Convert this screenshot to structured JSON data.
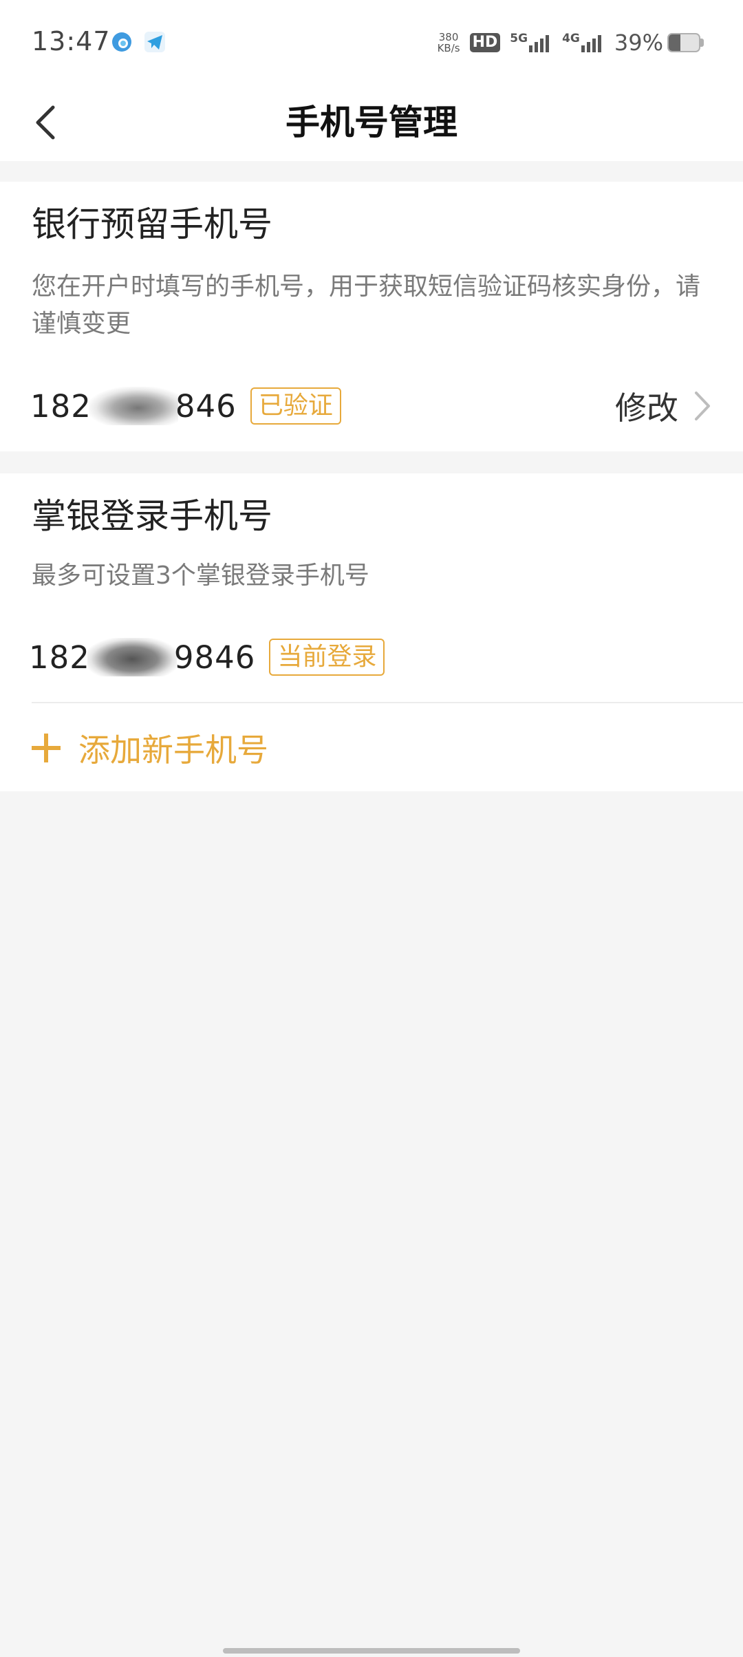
{
  "status_bar": {
    "time": "13:47",
    "net_speed_value": "380",
    "net_speed_unit": "KB/s",
    "hd_label": "HD",
    "sim1_label": "5G",
    "sim2_label": "4G",
    "battery_percent": "39%",
    "battery_level": 0.39,
    "app_icons": [
      "browser-app-icon",
      "telegram-app-icon"
    ]
  },
  "nav": {
    "title": "手机号管理",
    "back_icon": "chevron-left-icon"
  },
  "bank_phone": {
    "title": "银行预留手机号",
    "description": "您在开户时填写的手机号，用于获取短信验证码核实身份，请谨慎变更",
    "number_prefix": "182",
    "number_suffix": "846",
    "badge": "已验证",
    "action_label": "修改",
    "action_icon": "chevron-right-icon"
  },
  "login_phones": {
    "title": "掌银登录手机号",
    "description": "最多可设置3个掌银登录手机号",
    "items": [
      {
        "number_prefix": "182",
        "number_suffix": "9846",
        "badge": "当前登录"
      }
    ],
    "add_label": "添加新手机号",
    "add_icon": "plus-icon"
  },
  "colors": {
    "accent": "#e7a93b",
    "background": "#f5f5f5",
    "card": "#ffffff",
    "text_primary": "#222222",
    "text_secondary": "#7a7a7a"
  }
}
